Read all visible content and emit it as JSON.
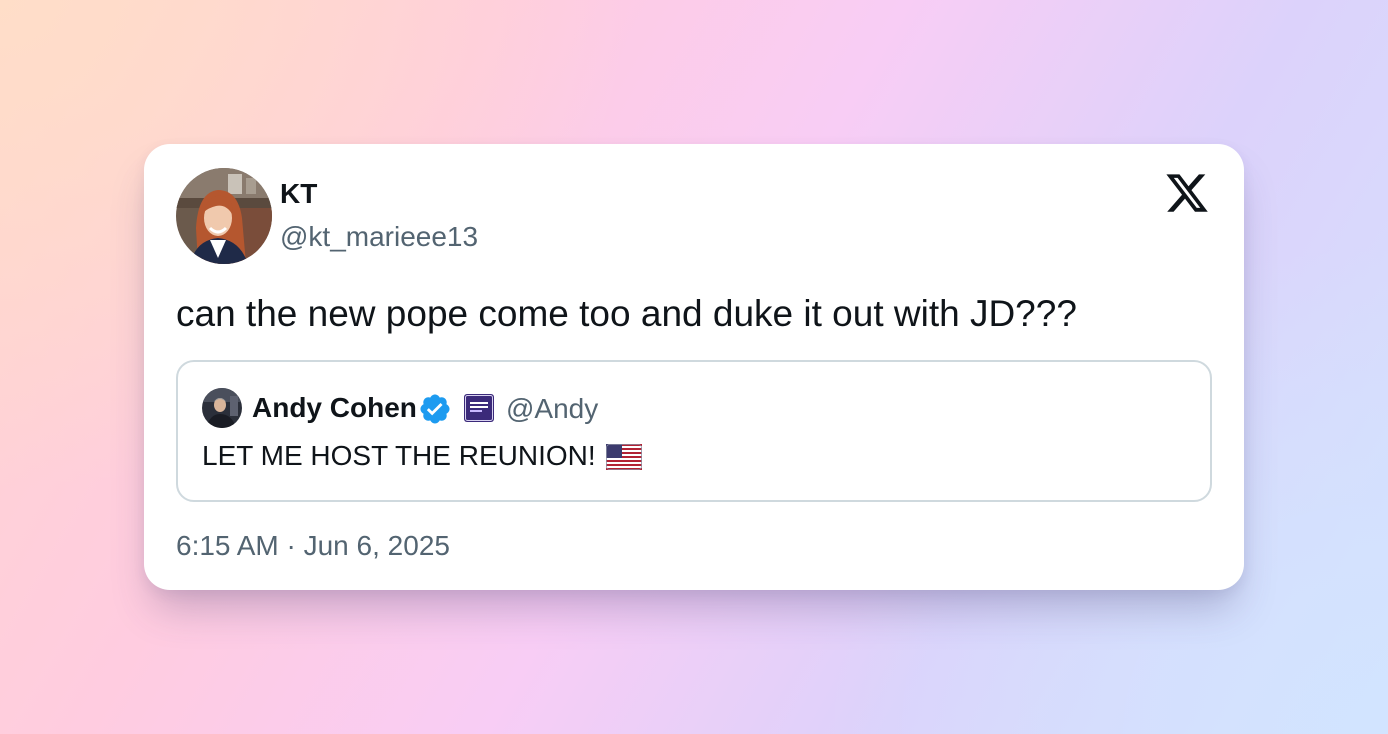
{
  "author": {
    "display_name": "KT",
    "handle": "@kt_marieee13",
    "avatar_icon": "profile-photo"
  },
  "tweet": {
    "text": "can the new pope come too and duke it out with JD???",
    "timestamp": "6:15 AM · Jun 6, 2025"
  },
  "quoted": {
    "display_name": "Andy Cohen",
    "handle": "@Andy",
    "verified": true,
    "verified_color": "#1d9bf0",
    "affiliate_icon": "affiliate-badge-icon",
    "text": "LET ME HOST THE REUNION!",
    "emoji": "us-flag-icon"
  },
  "brand": {
    "logo": "x-logo-icon",
    "text_color": "#0f1419",
    "secondary_color": "#536471",
    "border_color": "#cfd9de"
  }
}
